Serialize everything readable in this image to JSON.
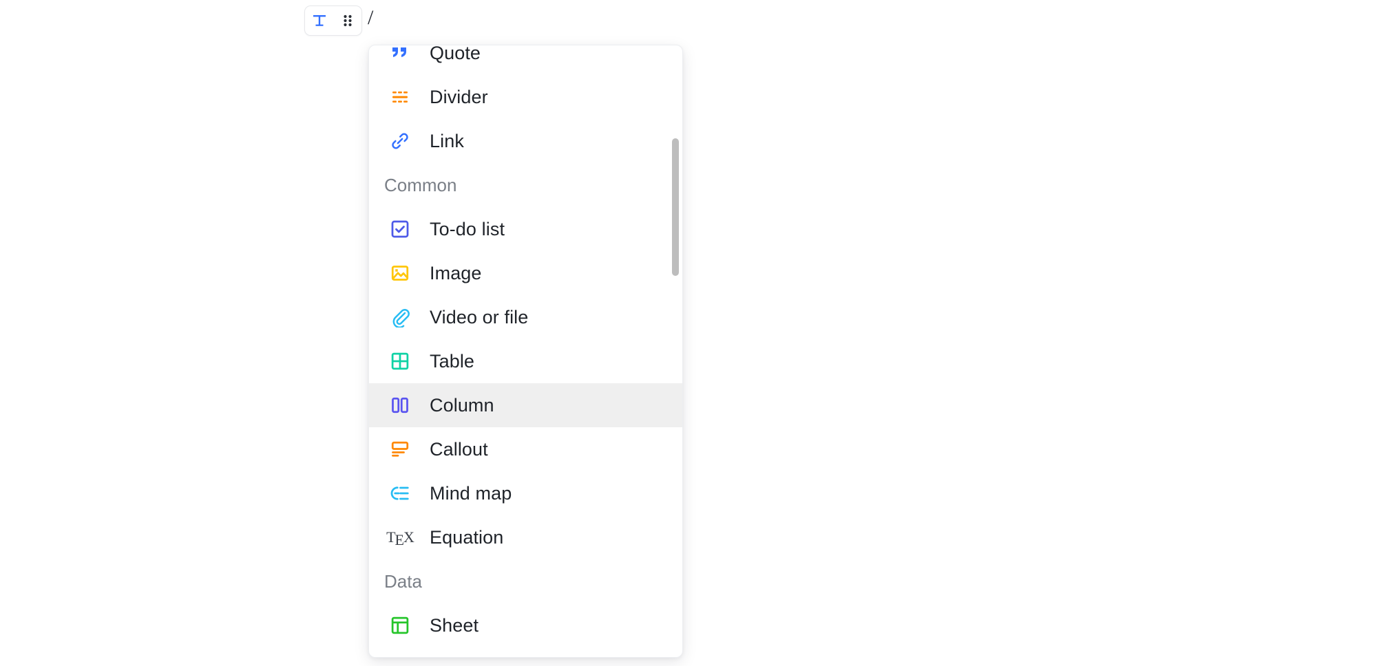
{
  "editor": {
    "typed_text": "/",
    "toolbar": {
      "text_type_label": "T",
      "drag_handle_label": "drag-handle"
    }
  },
  "slash_menu": {
    "selected_item": "Column",
    "groups": [
      {
        "label": "",
        "items": [
          {
            "label": "Quote",
            "icon": "quote-icon",
            "color": "#3370ff"
          },
          {
            "label": "Divider",
            "icon": "divider-icon",
            "color": "#ff8800"
          },
          {
            "label": "Link",
            "icon": "link-icon",
            "color": "#3370ff"
          }
        ]
      },
      {
        "label": "Common",
        "items": [
          {
            "label": "To-do list",
            "icon": "checkbox-icon",
            "color": "#4e5ae8"
          },
          {
            "label": "Image",
            "icon": "image-icon",
            "color": "#ffc60a"
          },
          {
            "label": "Video or file",
            "icon": "paperclip-icon",
            "color": "#27bcf3"
          },
          {
            "label": "Table",
            "icon": "table-icon",
            "color": "#0fd2a5"
          },
          {
            "label": "Column",
            "icon": "column-icon",
            "color": "#5a54f0"
          },
          {
            "label": "Callout",
            "icon": "callout-icon",
            "color": "#ff8800"
          },
          {
            "label": "Mind map",
            "icon": "mindmap-icon",
            "color": "#27bcf3"
          },
          {
            "label": "Equation",
            "icon": "tex-icon",
            "color": "#3c4149"
          }
        ]
      },
      {
        "label": "Data",
        "items": [
          {
            "label": "Sheet",
            "icon": "sheet-icon",
            "color": "#25c52a"
          }
        ]
      }
    ]
  }
}
